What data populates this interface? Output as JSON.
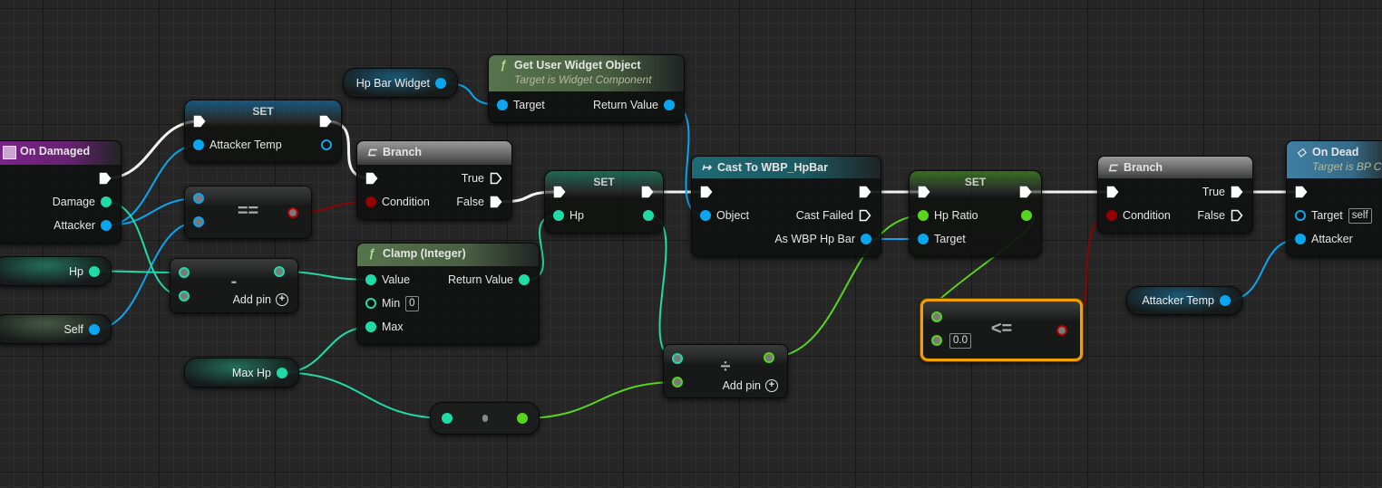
{
  "colors": {
    "exec": "#ffffff",
    "object": "#0aa6f0",
    "int": "#1fdca6",
    "float": "#58d41e",
    "bool": "#950000",
    "event": "#7b2489",
    "function": "#56734d",
    "branch": "#7d7d7d",
    "cast": "#1e6a74",
    "custom_event": "#3f7fa3",
    "selection": "#f0a000"
  },
  "nodes": [
    {
      "id": "onDamaged",
      "kind": "event",
      "icon": "event-icon",
      "title": "On Damaged",
      "rows": [
        {
          "right": {
            "key": "then",
            "type": "exec",
            "connected": true
          }
        },
        {
          "right": {
            "key": "damage",
            "type": "int",
            "label": "Damage",
            "connected": true
          }
        },
        {
          "right": {
            "key": "attacker",
            "type": "object",
            "label": "Attacker",
            "connected": true
          }
        }
      ]
    },
    {
      "id": "hpVar",
      "kind": "var",
      "label": "Hp",
      "type": "int"
    },
    {
      "id": "selfVar",
      "kind": "var",
      "label": "Self",
      "type": "self"
    },
    {
      "id": "set1",
      "kind": "set",
      "title": "SET",
      "glow": "object",
      "rows": [
        {
          "left": {
            "key": "in",
            "type": "exec",
            "connected": true
          },
          "right": {
            "key": "out",
            "type": "exec",
            "connected": true
          }
        },
        {
          "left": {
            "key": "val",
            "type": "object",
            "label": "Attacker Temp",
            "connected": true
          },
          "right": {
            "key": "outv",
            "type": "object",
            "connected": false
          }
        }
      ]
    },
    {
      "id": "eq",
      "kind": "op",
      "symbol": "==",
      "outCenter": true,
      "inType": "object",
      "outType": "bool",
      "inputs": [
        "a",
        "b"
      ]
    },
    {
      "id": "minus",
      "kind": "op",
      "symbol": "-",
      "inType": "int",
      "outType": "int",
      "inputs": [
        "a",
        "b"
      ],
      "add_pin": "Add pin"
    },
    {
      "id": "hpBarWidget",
      "kind": "var",
      "label": "Hp Bar Widget",
      "type": "object"
    },
    {
      "id": "guwo",
      "kind": "function",
      "icon": "function-icon",
      "title": "Get User Widget Object",
      "subtitle": "Target is Widget Component",
      "rows": [
        {
          "left": {
            "key": "target",
            "type": "object",
            "label": "Target",
            "connected": true
          },
          "right": {
            "key": "ret",
            "type": "object",
            "label": "Return Value",
            "connected": true
          }
        }
      ]
    },
    {
      "id": "branch1",
      "kind": "branch",
      "icon": "branch-icon",
      "title": "Branch",
      "rows": [
        {
          "left": {
            "key": "in",
            "type": "exec",
            "connected": true
          },
          "right": {
            "key": "true",
            "type": "exec",
            "label": "True",
            "connected": false
          }
        },
        {
          "left": {
            "key": "cond",
            "type": "bool",
            "label": "Condition",
            "connected": true
          },
          "right": {
            "key": "false",
            "type": "exec",
            "label": "False",
            "connected": true
          }
        }
      ]
    },
    {
      "id": "clamp",
      "kind": "function",
      "icon": "function-icon",
      "title": "Clamp (Integer)",
      "rows": [
        {
          "left": {
            "key": "value",
            "type": "int",
            "label": "Value",
            "connected": true
          },
          "right": {
            "key": "ret",
            "type": "int",
            "label": "Return Value",
            "connected": true
          }
        },
        {
          "left": {
            "key": "min",
            "type": "int",
            "label": "Min",
            "connected": false,
            "default": "0"
          }
        },
        {
          "left": {
            "key": "max",
            "type": "int",
            "label": "Max",
            "connected": true
          }
        }
      ]
    },
    {
      "id": "set2",
      "kind": "set",
      "title": "SET",
      "glow": "int",
      "rows": [
        {
          "left": {
            "key": "in",
            "type": "exec",
            "connected": true
          },
          "right": {
            "key": "out",
            "type": "exec",
            "connected": true
          }
        },
        {
          "left": {
            "key": "val",
            "type": "int",
            "label": "Hp",
            "connected": true
          },
          "right": {
            "key": "outv",
            "type": "int",
            "connected": true
          }
        }
      ]
    },
    {
      "id": "maxHpVar",
      "kind": "var",
      "label": "Max Hp",
      "type": "int"
    },
    {
      "id": "conv",
      "kind": "conv"
    },
    {
      "id": "divide",
      "kind": "op",
      "symbol": "÷",
      "inType": "mixed",
      "outType": "float",
      "inputs": [
        "a",
        "b"
      ],
      "add_pin": "Add pin"
    },
    {
      "id": "cast",
      "kind": "cast",
      "icon": "cast-icon",
      "title": "Cast To WBP_HpBar",
      "rows": [
        {
          "left": {
            "key": "in",
            "type": "exec",
            "connected": true
          },
          "right": {
            "key": "out",
            "type": "exec",
            "connected": true
          }
        },
        {
          "left": {
            "key": "obj",
            "type": "object",
            "label": "Object",
            "connected": true
          },
          "right": {
            "key": "failed",
            "type": "exec",
            "label": "Cast Failed",
            "connected": false
          }
        },
        {
          "right": {
            "key": "as",
            "type": "object",
            "label": "As WBP Hp Bar",
            "connected": true
          }
        }
      ]
    },
    {
      "id": "set3",
      "kind": "set",
      "title": "SET",
      "glow": "float",
      "rows": [
        {
          "left": {
            "key": "in",
            "type": "exec",
            "connected": true
          },
          "right": {
            "key": "out",
            "type": "exec",
            "connected": true
          }
        },
        {
          "left": {
            "key": "val",
            "type": "float",
            "label": "Hp Ratio",
            "connected": true
          },
          "right": {
            "key": "outv",
            "type": "float",
            "connected": true
          }
        },
        {
          "left": {
            "key": "target",
            "type": "object",
            "label": "Target",
            "connected": true
          }
        }
      ]
    },
    {
      "id": "lte",
      "kind": "op",
      "symbol": "<=",
      "outCenter": true,
      "selected": true,
      "inType": "float",
      "outType": "bool",
      "inputs": [
        "a",
        "b"
      ],
      "b_default": "0.0"
    },
    {
      "id": "branch2",
      "kind": "branch",
      "icon": "branch-icon",
      "title": "Branch",
      "rows": [
        {
          "left": {
            "key": "in",
            "type": "exec",
            "connected": true
          },
          "right": {
            "key": "true",
            "type": "exec",
            "label": "True",
            "connected": true
          }
        },
        {
          "left": {
            "key": "cond",
            "type": "bool",
            "label": "Condition",
            "connected": true
          },
          "right": {
            "key": "false",
            "type": "exec",
            "label": "False",
            "connected": false
          }
        }
      ]
    },
    {
      "id": "onDead",
      "kind": "custom_event",
      "icon": "custom-event-icon",
      "title": "On Dead",
      "subtitle": "Target is BP C",
      "rows": [
        {
          "left": {
            "key": "in",
            "type": "exec",
            "connected": true
          }
        },
        {
          "left": {
            "key": "target",
            "type": "object",
            "label": "Target",
            "connected": false,
            "default": "self"
          }
        },
        {
          "left": {
            "key": "attacker",
            "type": "object",
            "label": "Attacker",
            "connected": true
          }
        }
      ]
    },
    {
      "id": "attackerTempVar",
      "kind": "var",
      "label": "Attacker Temp",
      "type": "object"
    }
  ],
  "wires": [
    {
      "from": "onDamaged.then",
      "to": "set1.in",
      "type": "exec"
    },
    {
      "from": "set1.out",
      "to": "branch1.in",
      "type": "exec"
    },
    {
      "from": "branch1.false",
      "to": "set2.in",
      "type": "exec"
    },
    {
      "from": "set2.out",
      "to": "cast.in",
      "type": "exec"
    },
    {
      "from": "cast.out",
      "to": "set3.in",
      "type": "exec"
    },
    {
      "from": "set3.out",
      "to": "branch2.in",
      "type": "exec"
    },
    {
      "from": "branch2.true",
      "to": "onDead.in",
      "type": "exec"
    },
    {
      "from": "onDamaged.attacker",
      "to": "set1.val",
      "type": "object"
    },
    {
      "from": "onDamaged.attacker",
      "to": "eq.a",
      "type": "object"
    },
    {
      "from": "selfVar.out",
      "to": "eq.b",
      "type": "object"
    },
    {
      "from": "hpBarWidget.out",
      "to": "guwo.target",
      "type": "object"
    },
    {
      "from": "guwo.ret",
      "to": "cast.obj",
      "type": "object"
    },
    {
      "from": "cast.as",
      "to": "set3.target",
      "type": "object"
    },
    {
      "from": "attackerTempVar.out",
      "to": "onDead.attacker",
      "type": "object"
    },
    {
      "from": "eq.out",
      "to": "branch1.cond",
      "type": "bool"
    },
    {
      "from": "lte.out",
      "to": "branch2.cond",
      "type": "bool"
    },
    {
      "from": "hpVar.out",
      "to": "minus.a",
      "type": "int"
    },
    {
      "from": "onDamaged.damage",
      "to": "minus.b",
      "type": "int"
    },
    {
      "from": "minus.out",
      "to": "clamp.value",
      "type": "int"
    },
    {
      "from": "clamp.ret",
      "to": "set2.val",
      "type": "int"
    },
    {
      "from": "set2.outv",
      "to": "divide.a",
      "type": "int"
    },
    {
      "from": "maxHpVar.out",
      "to": "clamp.max",
      "type": "int"
    },
    {
      "from": "maxHpVar.out",
      "to": "conv.in",
      "type": "int"
    },
    {
      "from": "conv.out",
      "to": "divide.b",
      "type": "float"
    },
    {
      "from": "divide.out",
      "to": "set3.val",
      "type": "float"
    },
    {
      "from": "set3.outv",
      "to": "lte.a",
      "type": "float"
    }
  ]
}
